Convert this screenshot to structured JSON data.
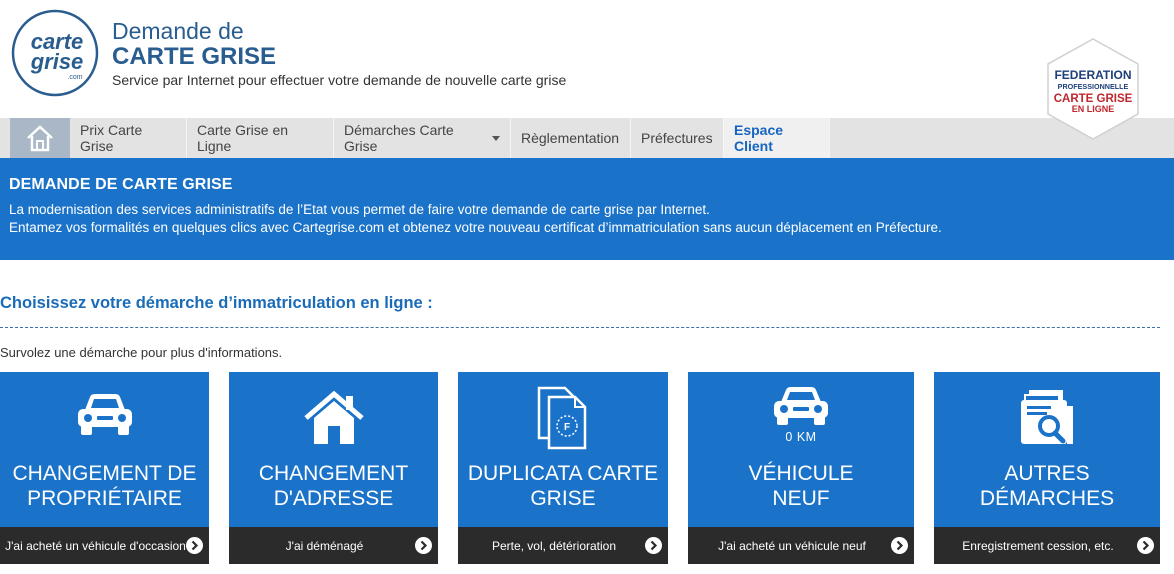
{
  "header": {
    "logo_line1": "carte",
    "logo_line2": "grise",
    "logo_line3": ".com",
    "title_line1": "Demande de",
    "title_line2": "CARTE GRISE",
    "tagline": "Service par Internet pour effectuer votre demande de nouvelle carte grise",
    "badge": {
      "line1": "FEDERATION",
      "line2": "PROFESSIONNELLE",
      "line3": "CARTE GRISE",
      "line4": "EN LIGNE"
    }
  },
  "nav": {
    "home_icon": "home-icon",
    "items": [
      {
        "label": "Prix Carte Grise"
      },
      {
        "label": "Carte Grise en Ligne"
      },
      {
        "label": "Démarches Carte Grise"
      },
      {
        "label": "Règlementation"
      },
      {
        "label": "Préfectures"
      },
      {
        "label": "Espace Client"
      }
    ]
  },
  "banner": {
    "title": "DEMANDE DE CARTE GRISE",
    "line1": "La modernisation des services administratifs de l’Etat vous permet de faire votre demande de carte grise par Internet.",
    "line2": "Entamez vos formalités en quelques clics avec Cartegrise.com et obtenez votre nouveau certificat d’immatriculation sans aucun déplacement en Préfecture."
  },
  "section": {
    "title": "Choisissez votre démarche d’immatriculation en ligne :",
    "hint": "Survolez une démarche pour plus d'informations."
  },
  "cards": [
    {
      "icon": "car-icon",
      "title_line1": "CHANGEMENT DE",
      "title_line2": "PROPRIÉTAIRE",
      "footer": "J'ai acheté un véhicule d'occasion"
    },
    {
      "icon": "house-icon",
      "title_line1": "CHANGEMENT",
      "title_line2": "D'ADRESSE",
      "footer": "J'ai déménagé"
    },
    {
      "icon": "documents-icon",
      "title_line1": "DUPLICATA CARTE",
      "title_line2": "GRISE",
      "footer": "Perte, vol, détérioration"
    },
    {
      "icon": "new-car-icon",
      "km": "0 KM",
      "title_line1": "VÉHICULE",
      "title_line2": "NEUF",
      "footer": "J'ai acheté un véhicule neuf"
    },
    {
      "icon": "search-documents-icon",
      "title_line1": "AUTRES",
      "title_line2": "DÉMARCHES",
      "footer": "Enregistrement cession, etc."
    }
  ],
  "colors": {
    "brand_blue": "#1a73c9",
    "title_blue": "#2a5d8f",
    "footer_dark": "#2b2b2b",
    "nav_bg": "#e3e3e3"
  }
}
